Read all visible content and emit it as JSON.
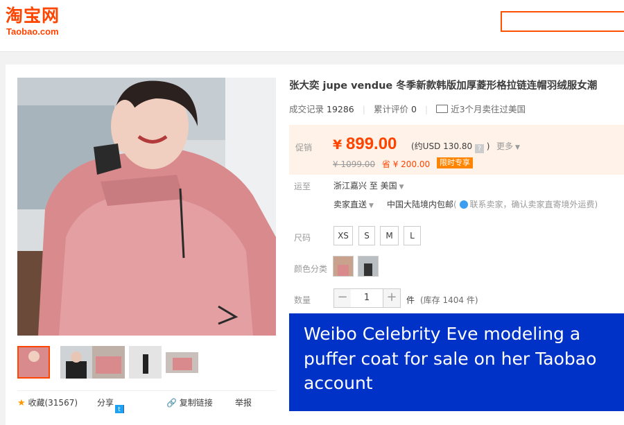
{
  "header": {
    "logo_cn": "淘宝网",
    "logo_en": "Taobao.com",
    "search_placeholder": ""
  },
  "product": {
    "title": "张大奕 jupe vendue 冬季新款韩版加厚菱形格拉链连帽羽绒服女潮",
    "stats": {
      "sales_label": "成交记录",
      "sales_count": "19286",
      "reviews_label": "累计评价",
      "reviews_count": "0",
      "shipped_note": "近3个月卖往过美国"
    },
    "price": {
      "label": "促销",
      "currency_symbol": "¥",
      "current": "899.00",
      "usd": "(约USD 130.80",
      "help_icon": "?",
      "usd_close": ")",
      "more": "更多",
      "original": "¥ 1099.00",
      "savings": "省 ¥ 200.00",
      "limited_badge": "限时专享"
    },
    "shipping": {
      "label": "运至",
      "route": "浙江嘉兴 至",
      "destination": "美国",
      "seller_ship": "卖家直送",
      "free_ship": "中国大陆境内包邮",
      "contact_open": "(",
      "contact_note": "联系卖家，确认卖家直寄境外运费)"
    },
    "sizes": {
      "label": "尺码",
      "options": [
        "XS",
        "S",
        "M",
        "L"
      ]
    },
    "colors": {
      "label": "颜色分类"
    },
    "quantity": {
      "label": "数量",
      "minus": "−",
      "value": "1",
      "plus": "+",
      "unit": "件",
      "stock": "(库存 1404 件)"
    },
    "social": {
      "favorite": "收藏(31567)",
      "share": "分享",
      "copy_link": "复制链接",
      "report": "举报"
    }
  },
  "caption": {
    "text": "Weibo Celebrity Eve modeling a puffer coat for sale on her Taobao account"
  },
  "colors": {
    "brand": "#ff4400",
    "caption_bg": "#0032c8",
    "price_bg": "#fff2e8"
  }
}
